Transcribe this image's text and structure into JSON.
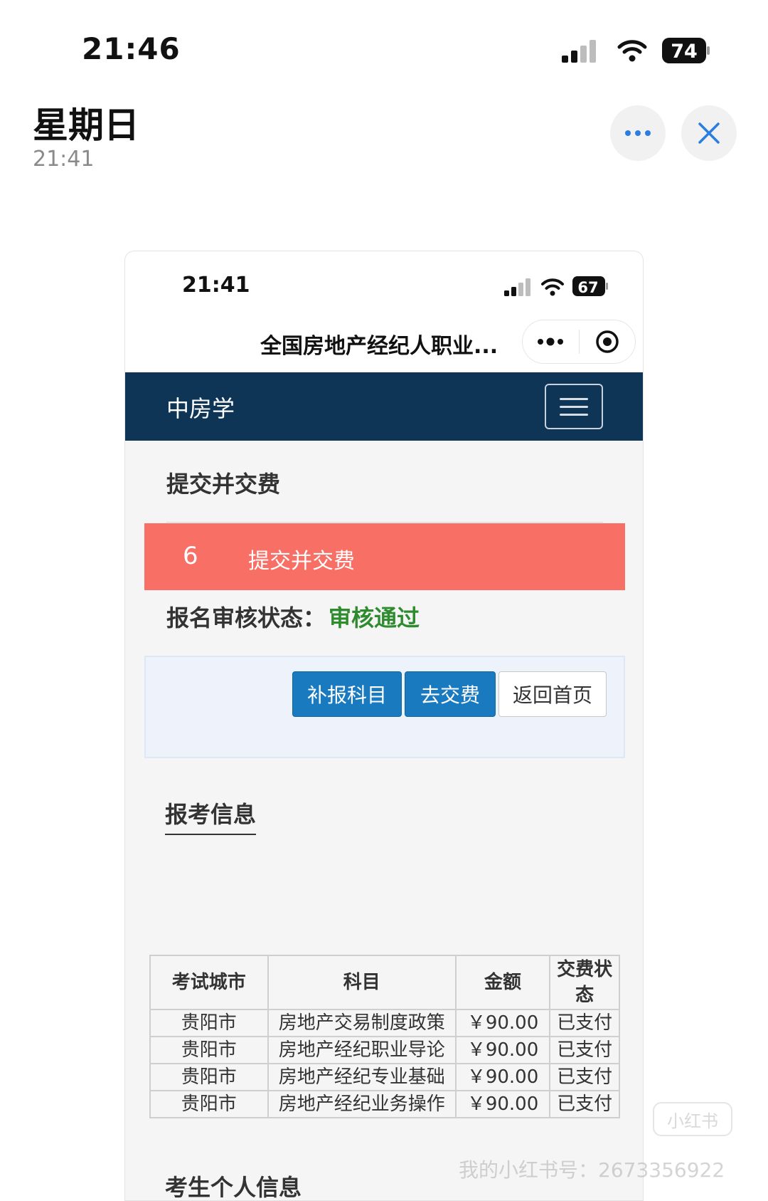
{
  "outer_status": {
    "time": "21:46",
    "battery": "74"
  },
  "viewer": {
    "title": "星期日",
    "time": "21:41"
  },
  "inner_status": {
    "time": "21:41",
    "battery": "67"
  },
  "miniprogram": {
    "title": "全国房地产经纪人职业..."
  },
  "navbar": {
    "brand": "中房学"
  },
  "page": {
    "heading": "提交并交费"
  },
  "step": {
    "number": "6",
    "label": "提交并交费"
  },
  "review": {
    "label": "报名审核状态：",
    "value": "审核通过"
  },
  "actions": {
    "supplement": "补报科目",
    "pay": "去交费",
    "home": "返回首页"
  },
  "sections": {
    "exam_info": "报考信息",
    "personal_info": "考生个人信息"
  },
  "fee_table": {
    "headers": [
      "考试城市",
      "科目",
      "金额",
      "交费状态"
    ],
    "rows": [
      [
        "贵阳市",
        "房地产交易制度政策",
        "￥90.00",
        "已支付"
      ],
      [
        "贵阳市",
        "房地产经纪职业导论",
        "￥90.00",
        "已支付"
      ],
      [
        "贵阳市",
        "房地产经纪专业基础",
        "￥90.00",
        "已支付"
      ],
      [
        "贵阳市",
        "房地产经纪业务操作",
        "￥90.00",
        "已支付"
      ]
    ]
  },
  "watermark": {
    "text": "我的小红书号：2673356922",
    "logo": "小红书"
  },
  "colors": {
    "navbar": "#0e3456",
    "step_banner": "#f86f66",
    "primary_button": "#1a7ac0",
    "approved": "#2e8b2e",
    "close_icon": "#2a7de1"
  }
}
